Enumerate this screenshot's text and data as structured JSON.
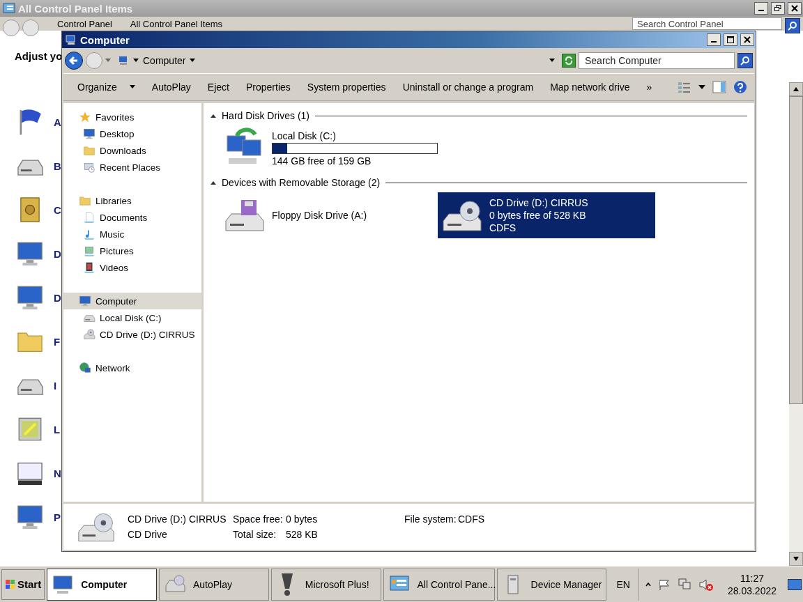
{
  "background_window": {
    "title": "All Control Panel Items",
    "address": [
      "Control Panel",
      "All Control Panel Items"
    ],
    "search": {
      "placeholder": "Search Control Panel"
    },
    "heading": "Adjust yo",
    "items": [
      {
        "label": "A"
      },
      {
        "label": "B"
      },
      {
        "label": "C"
      },
      {
        "label": "D"
      },
      {
        "label": "D"
      },
      {
        "label": "F"
      },
      {
        "label": "I"
      },
      {
        "label": "L"
      },
      {
        "label": "N"
      },
      {
        "label": "P"
      }
    ]
  },
  "window": {
    "title": "Computer",
    "address": "Computer",
    "search": {
      "placeholder": "Search Computer"
    },
    "toolbar": [
      {
        "label": "Organize",
        "kind": "menu"
      },
      {
        "label": "AutoPlay",
        "kind": "command"
      },
      {
        "label": "Eject",
        "kind": "command"
      },
      {
        "label": "Properties",
        "kind": "command"
      },
      {
        "label": "System properties",
        "kind": "command"
      },
      {
        "label": "Uninstall or change a program",
        "kind": "command"
      },
      {
        "label": "Map network drive",
        "kind": "command"
      }
    ],
    "more": "»",
    "sidebar": [
      {
        "label": "Favorites",
        "selected": false,
        "children": [
          {
            "label": "Desktop",
            "selected": false
          },
          {
            "label": "Downloads",
            "selected": false
          },
          {
            "label": "Recent Places",
            "selected": false
          }
        ]
      },
      {
        "label": "Libraries",
        "selected": false,
        "children": [
          {
            "label": "Documents",
            "selected": false
          },
          {
            "label": "Music",
            "selected": false
          },
          {
            "label": "Pictures",
            "selected": false
          },
          {
            "label": "Videos",
            "selected": false
          }
        ]
      },
      {
        "label": "Computer",
        "selected": true,
        "children": [
          {
            "label": "Local Disk (C:)",
            "selected": false
          },
          {
            "label": "CD Drive (D:) CIRRUS",
            "selected": false
          }
        ]
      },
      {
        "label": "Network",
        "selected": false
      }
    ],
    "sections": [
      {
        "title": "Hard Disk Drives (1)",
        "expanded": true,
        "items": [
          {
            "name": "Local Disk (C:)",
            "kind": "disk",
            "level": 0.09,
            "lines": [
              "144 GB free of 159 GB"
            ],
            "selected": false
          }
        ]
      },
      {
        "title": "Devices with Removable Storage (2)",
        "expanded": true,
        "items": [
          {
            "name": "Floppy Disk Drive (A:)",
            "kind": "floppy",
            "selected": false
          },
          {
            "name": "CD Drive (D:) CIRRUS",
            "kind": "cd",
            "lines": [
              "0 bytes free of 528 KB",
              "CDFS"
            ],
            "selected": true
          }
        ]
      }
    ],
    "details": {
      "name": "CD Drive (D:) CIRRUS",
      "type": "CD Drive",
      "fields": [
        {
          "label": "Space free:",
          "value": "0 bytes"
        },
        {
          "label": "Total size:",
          "value": "528 KB"
        },
        {
          "label": "File system:",
          "value": "CDFS"
        }
      ]
    }
  },
  "taskbar": {
    "start": "Start",
    "buttons": [
      {
        "label": "Computer",
        "selected": true
      },
      {
        "label": "AutoPlay",
        "selected": false
      },
      {
        "label": "Microsoft Plus!",
        "selected": false
      },
      {
        "label": "All Control Pane...",
        "selected": false
      },
      {
        "label": "Device Manager",
        "selected": false
      }
    ],
    "language": "EN",
    "time": "11:27",
    "date": "28.03.2022"
  }
}
